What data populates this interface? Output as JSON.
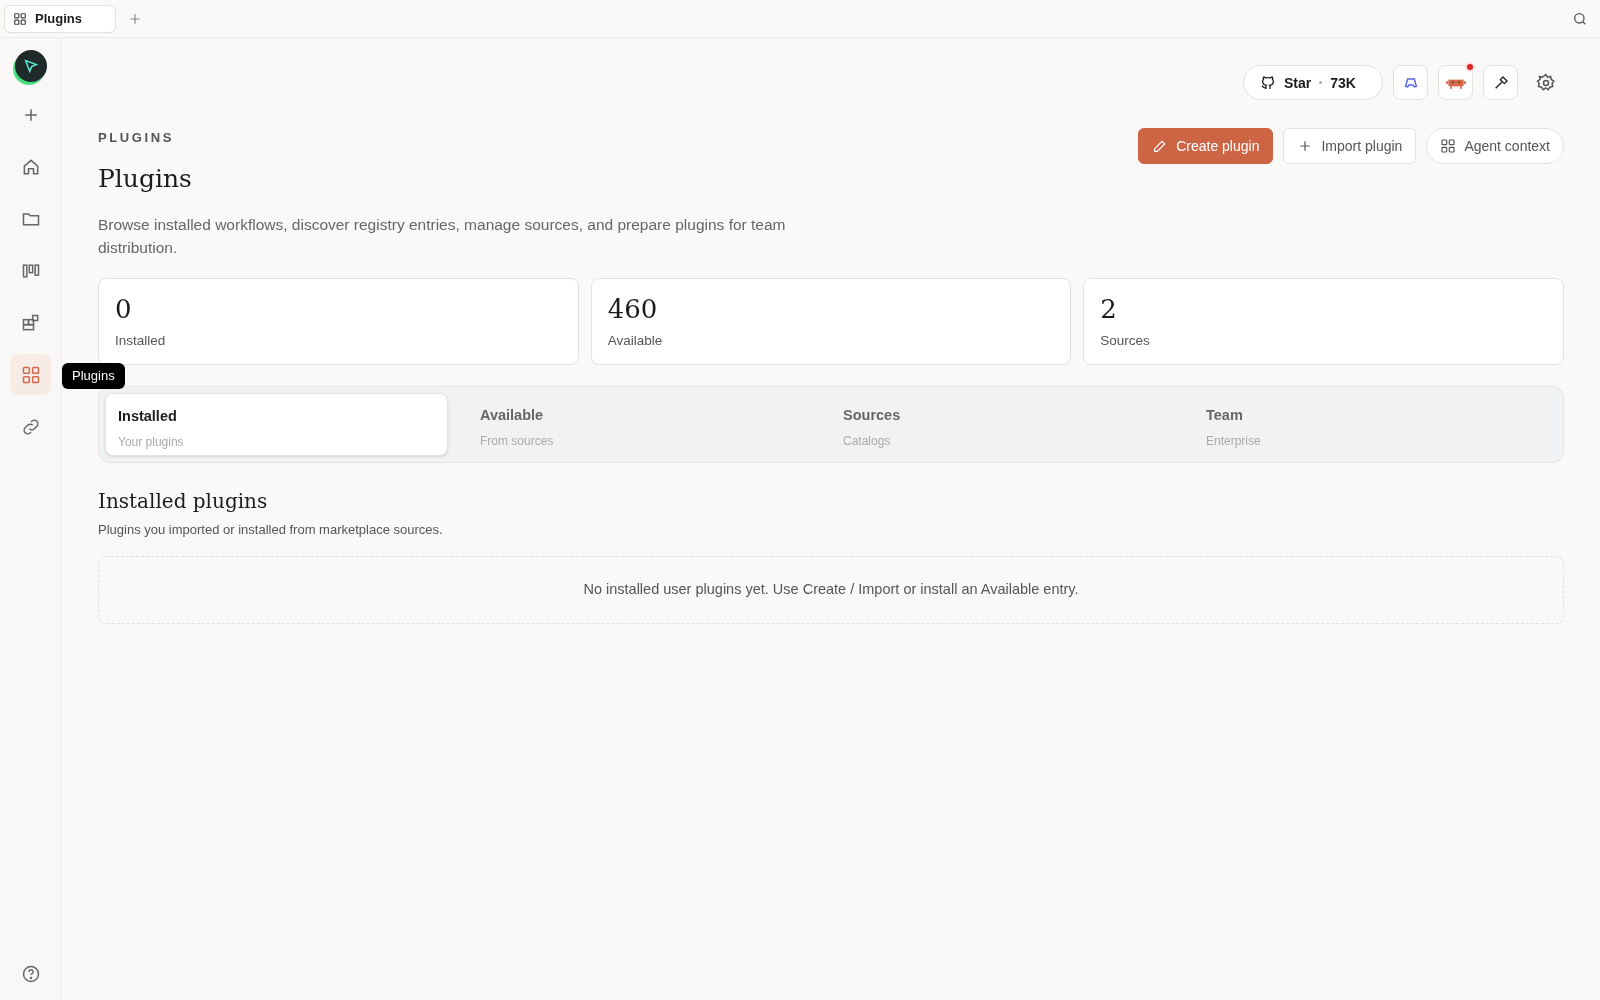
{
  "browser_tabs": [
    {
      "label": "Plugins",
      "selected": true
    }
  ],
  "sidebar": {
    "items": [
      {
        "kind": "new",
        "selected": false
      },
      {
        "kind": "home",
        "selected": false
      },
      {
        "kind": "folder",
        "selected": false
      },
      {
        "kind": "board",
        "selected": false
      },
      {
        "kind": "blocks",
        "selected": false
      },
      {
        "kind": "plugins",
        "selected": true,
        "tooltip": "Plugins"
      },
      {
        "kind": "link",
        "selected": false
      }
    ]
  },
  "header": {
    "star_label": "Star",
    "star_count": "73K",
    "notification": true
  },
  "page": {
    "eyebrow": "PLUGINS",
    "title": "Plugins",
    "description": "Browse installed workflows, discover registry entries, manage sources, and prepare plugins for team distribution.",
    "actions": [
      {
        "kind": "primary",
        "label": "Create plugin"
      },
      {
        "kind": "import",
        "label": "Import plugin"
      },
      {
        "kind": "context",
        "label": "Agent context"
      }
    ]
  },
  "stats": [
    {
      "value": "0",
      "label": "Installed"
    },
    {
      "value": "460",
      "label": "Available"
    },
    {
      "value": "2",
      "label": "Sources"
    }
  ],
  "tabs": [
    {
      "label": "Installed",
      "sub": "Your plugins",
      "selected": true
    },
    {
      "label": "Available",
      "sub": "From sources",
      "selected": false
    },
    {
      "label": "Sources",
      "sub": "Catalogs",
      "selected": false
    },
    {
      "label": "Team",
      "sub": "Enterprise",
      "selected": false
    }
  ],
  "section": {
    "title": "Installed plugins",
    "subtitle": "Plugins you imported or installed from marketplace sources.",
    "empty_message": "No installed user plugins yet. Use Create / Import or install an Available entry."
  }
}
